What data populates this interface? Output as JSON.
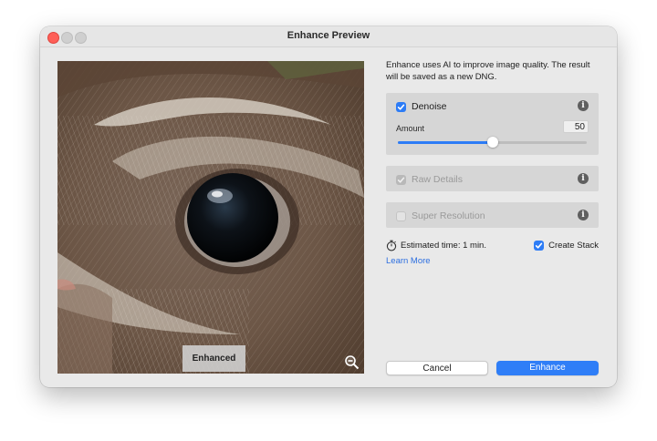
{
  "window": {
    "title": "Enhance Preview"
  },
  "preview": {
    "overlay_label": "Enhanced",
    "zoom_icon": "zoom-out-icon"
  },
  "description": "Enhance uses AI to improve image quality. The result will be saved as a new DNG.",
  "options": {
    "denoise": {
      "label": "Denoise",
      "checked": true,
      "amount_label": "Amount",
      "amount_value": "50",
      "amount_max": 100
    },
    "raw_details": {
      "label": "Raw Details",
      "checked": true,
      "disabled": true
    },
    "super_resolution": {
      "label": "Super Resolution",
      "checked": false,
      "disabled": true
    }
  },
  "estimate": {
    "text": "Estimated time: 1 min.",
    "icon": "stopwatch-icon"
  },
  "create_stack": {
    "label": "Create Stack",
    "checked": true
  },
  "learn_more": "Learn More",
  "buttons": {
    "cancel": "Cancel",
    "enhance": "Enhance"
  },
  "colors": {
    "accent": "#2f7ef7",
    "close": "#fe5f57",
    "link": "#2d6fe0"
  }
}
